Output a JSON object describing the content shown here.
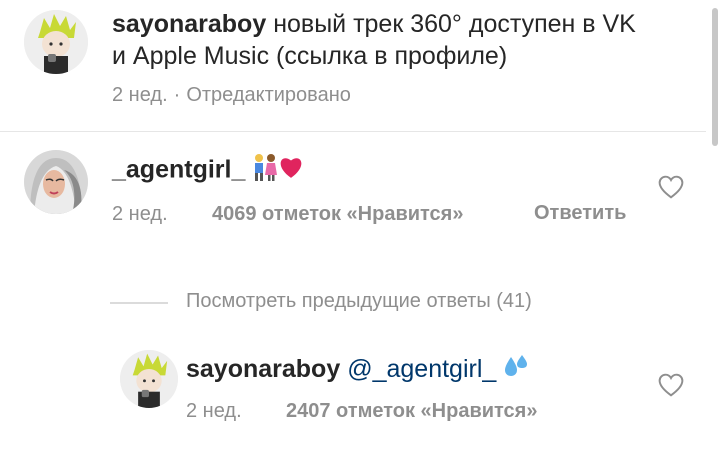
{
  "post": {
    "username": "sayonaraboy",
    "caption": "новый трек 360° доступен в VK и Apple Music (ссылка в профиле)",
    "time": "2 нед.",
    "separator": "·",
    "edited": "Отредактировано"
  },
  "comment": {
    "username": "_agentgirl_",
    "text": "",
    "emoji": [
      "couple-emoji",
      "heart-emoji"
    ],
    "time": "2 нед.",
    "likes": "4069 отметок «Нравится»",
    "reply": "Ответить"
  },
  "view_previous": "Посмотреть предыдущие ответы (41)",
  "reply_comment": {
    "username": "sayonaraboy",
    "mention": "@_agentgirl_",
    "emoji": "sweat-droplets-emoji",
    "time": "2 нед.",
    "likes": "2407 отметок «Нравится»"
  },
  "colors": {
    "text": "#262626",
    "secondary": "#8e8e8e",
    "mention": "#00376b",
    "heart_emoji": "#e0245e"
  }
}
